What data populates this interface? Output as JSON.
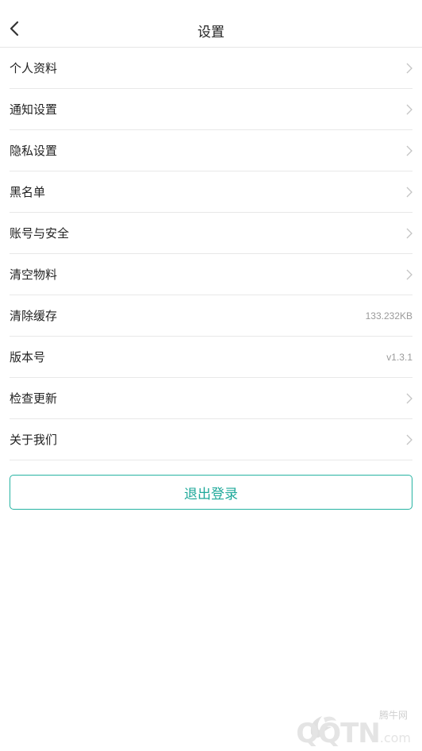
{
  "header": {
    "title": "设置"
  },
  "settings": {
    "items": [
      {
        "label": "个人资料",
        "value": "",
        "chevron": true
      },
      {
        "label": "通知设置",
        "value": "",
        "chevron": true
      },
      {
        "label": "隐私设置",
        "value": "",
        "chevron": true
      },
      {
        "label": "黑名单",
        "value": "",
        "chevron": true
      },
      {
        "label": "账号与安全",
        "value": "",
        "chevron": true
      },
      {
        "label": "清空物料",
        "value": "",
        "chevron": true
      },
      {
        "label": "清除缓存",
        "value": "133.232KB",
        "chevron": false
      },
      {
        "label": "版本号",
        "value": "v1.3.1",
        "chevron": false
      },
      {
        "label": "检查更新",
        "value": "",
        "chevron": true
      },
      {
        "label": "关于我们",
        "value": "",
        "chevron": true
      }
    ]
  },
  "logout_label": "退出登录",
  "watermark": {
    "cn": "腾牛网",
    "en": "QQTN",
    "suffix": ".com"
  },
  "colors": {
    "accent": "#1fa99a",
    "divider": "#e8e8e8",
    "secondary_text": "#9a9a9a"
  }
}
